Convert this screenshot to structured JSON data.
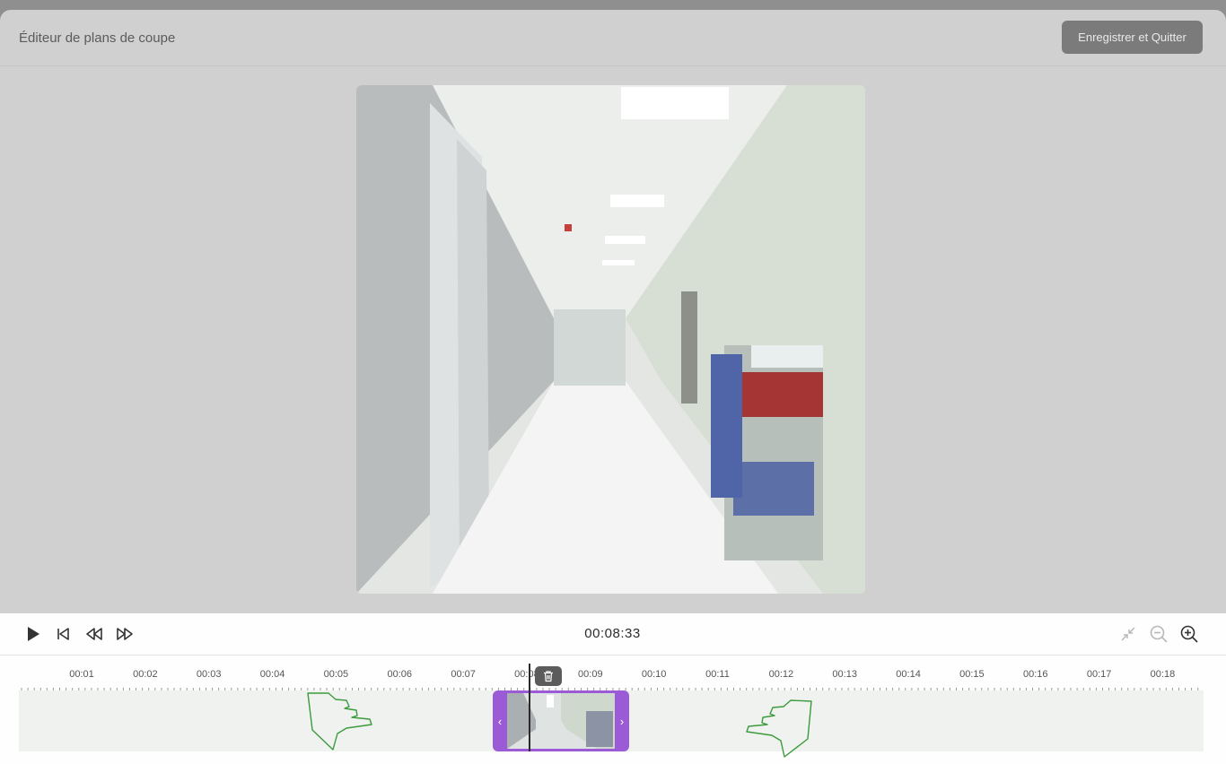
{
  "modal": {
    "title": "Éditeur de plans de coupe",
    "save_button": "Enregistrer et Quitter"
  },
  "player": {
    "timecode": "00:08:33",
    "controls": [
      "play-icon",
      "skip-start-icon",
      "rewind-icon",
      "fast-forward-icon"
    ],
    "zoom_controls": [
      "fit-timeline-icon",
      "zoom-out-icon",
      "zoom-in-icon"
    ]
  },
  "timeline": {
    "ticks": [
      "00:01",
      "00:02",
      "00:03",
      "00:04",
      "00:05",
      "00:06",
      "00:07",
      "00:08",
      "00:09",
      "00:10",
      "00:11",
      "00:12",
      "00:13",
      "00:14",
      "00:15",
      "00:16",
      "00:17",
      "00:18"
    ],
    "clip_color": "#9b5ad6",
    "clip_handles": [
      "‹",
      "›"
    ]
  },
  "colors": {
    "accent": "#9b5ad6",
    "hint_hand": "#3c9a3c"
  }
}
